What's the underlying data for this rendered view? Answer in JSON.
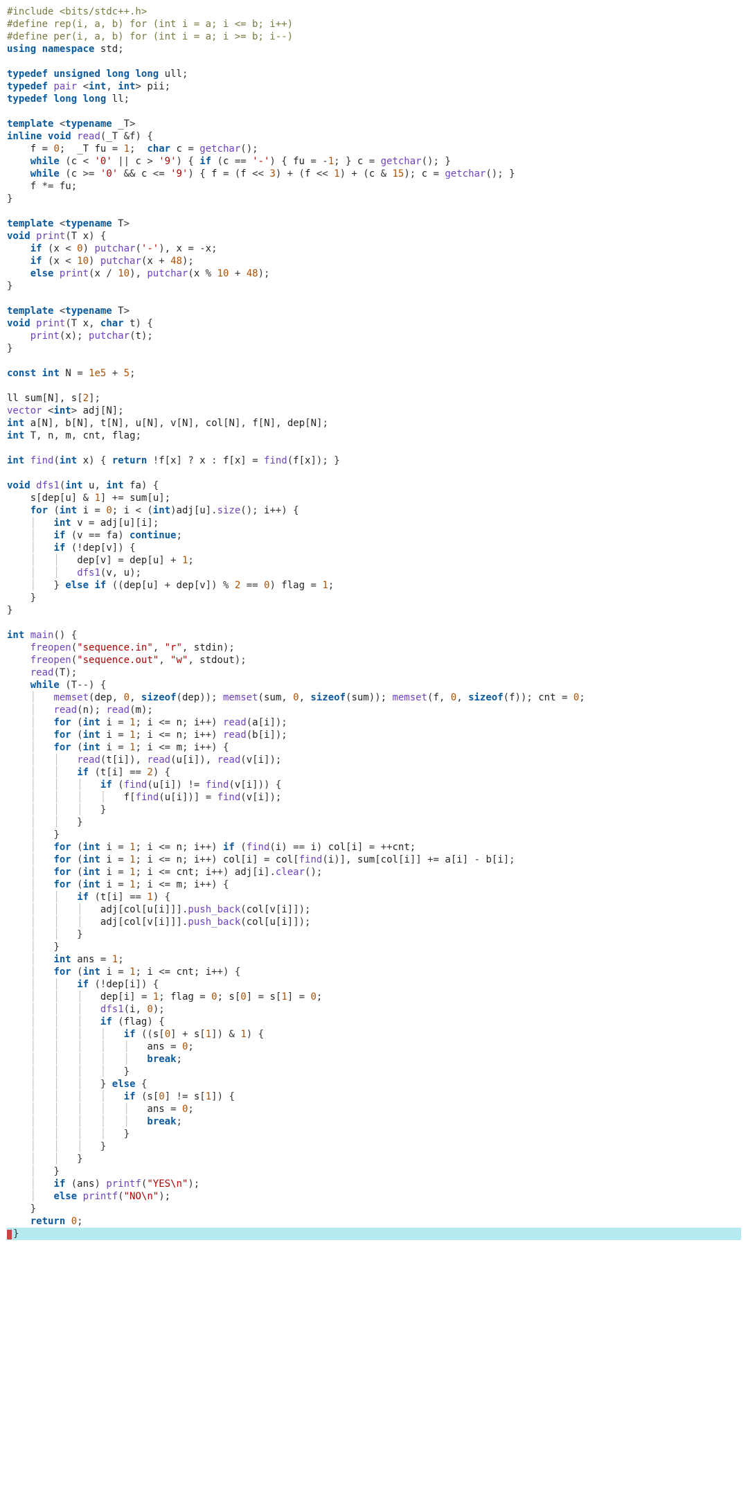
{
  "code_lines": [
    "#include <bits/stdc++.h>",
    "#define rep(i, a, b) for (int i = a; i <= b; i++)",
    "#define per(i, a, b) for (int i = a; i >= b; i--)",
    "using namespace std;",
    "",
    "typedef unsigned long long ull;",
    "typedef pair <int, int> pii;",
    "typedef long long ll;",
    "",
    "template <typename _T>",
    "inline void read(_T &f) {",
    "    f = 0;  _T fu = 1;  char c = getchar();",
    "    while (c < '0' || c > '9') { if (c == '-') { fu = -1; } c = getchar(); }",
    "    while (c >= '0' && c <= '9') { f = (f << 3) + (f << 1) + (c & 15); c = getchar(); }",
    "    f *= fu;",
    "}",
    "",
    "template <typename T>",
    "void print(T x) {",
    "    if (x < 0) putchar('-'), x = -x;",
    "    if (x < 10) putchar(x + 48);",
    "    else print(x / 10), putchar(x % 10 + 48);",
    "}",
    "",
    "template <typename T>",
    "void print(T x, char t) {",
    "    print(x); putchar(t);",
    "}",
    "",
    "const int N = 1e5 + 5;",
    "",
    "ll sum[N], s[2];",
    "vector <int> adj[N];",
    "int a[N], b[N], t[N], u[N], v[N], col[N], f[N], dep[N];",
    "int T, n, m, cnt, flag;",
    "",
    "int find(int x) { return !f[x] ? x : f[x] = find(f[x]); }",
    "",
    "void dfs1(int u, int fa) {",
    "    s[dep[u] & 1] += sum[u];",
    "    for (int i = 0; i < (int)adj[u].size(); i++) {",
    "        int v = adj[u][i];",
    "        if (v == fa) continue;",
    "        if (!dep[v]) {",
    "            dep[v] = dep[u] + 1;",
    "            dfs1(v, u);",
    "        } else if ((dep[u] + dep[v]) % 2 == 0) flag = 1;",
    "    }",
    "}",
    "",
    "int main() {",
    "    freopen(\"sequence.in\", \"r\", stdin);",
    "    freopen(\"sequence.out\", \"w\", stdout);",
    "    read(T);",
    "    while (T--) {",
    "        memset(dep, 0, sizeof(dep)); memset(sum, 0, sizeof(sum)); memset(f, 0, sizeof(f)); cnt = 0;",
    "        read(n); read(m);",
    "        for (int i = 1; i <= n; i++) read(a[i]);",
    "        for (int i = 1; i <= n; i++) read(b[i]);",
    "        for (int i = 1; i <= m; i++) {",
    "            read(t[i]), read(u[i]), read(v[i]);",
    "            if (t[i] == 2) {",
    "                if (find(u[i]) != find(v[i])) {",
    "                    f[find(u[i])] = find(v[i]);",
    "                }",
    "            }",
    "        }",
    "        for (int i = 1; i <= n; i++) if (find(i) == i) col[i] = ++cnt;",
    "        for (int i = 1; i <= n; i++) col[i] = col[find(i)], sum[col[i]] += a[i] - b[i];",
    "        for (int i = 1; i <= cnt; i++) adj[i].clear();",
    "        for (int i = 1; i <= m; i++) {",
    "            if (t[i] == 1) {",
    "                adj[col[u[i]]].push_back(col[v[i]]);",
    "                adj[col[v[i]]].push_back(col[u[i]]);",
    "            }",
    "        }",
    "        int ans = 1;",
    "        for (int i = 1; i <= cnt; i++) {",
    "            if (!dep[i]) {",
    "                dep[i] = 1; flag = 0; s[0] = s[1] = 0;",
    "                dfs1(i, 0);",
    "                if (flag) {",
    "                    if ((s[0] + s[1]) & 1) {",
    "                        ans = 0;",
    "                        break;",
    "                    }",
    "                } else {",
    "                    if (s[0] != s[1]) {",
    "                        ans = 0;",
    "                        break;",
    "                    }",
    "                }",
    "            }",
    "        }",
    "        if (ans) printf(\"YES\\n\");",
    "        else printf(\"NO\\n\");",
    "    }",
    "    return 0;",
    "}"
  ],
  "colors": {
    "preprocessor": "#7a7a40",
    "keyword": "#0a5aa0",
    "function": "#6f42c1",
    "number": "#b05000",
    "string": "#b00000",
    "guide": "#c0c0c0",
    "cursor_line_bg": "#b6eaf0",
    "caret": "#d04040"
  }
}
